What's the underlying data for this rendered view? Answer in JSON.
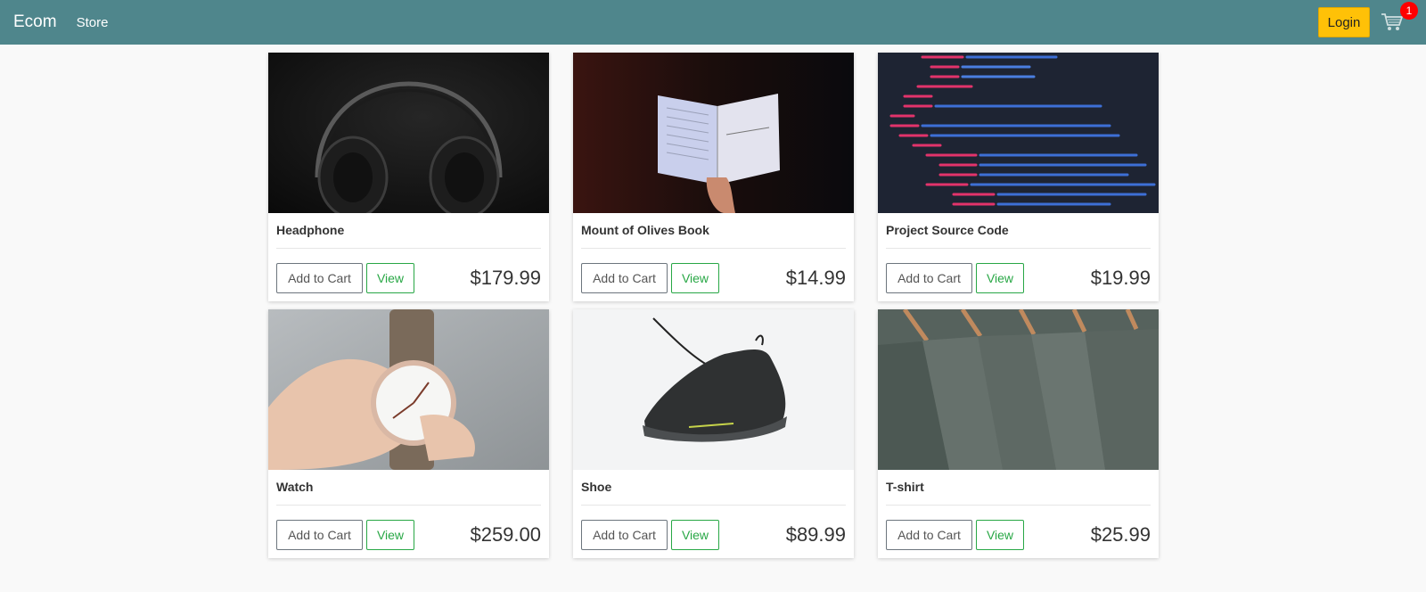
{
  "navbar": {
    "brand": "Ecom",
    "store_label": "Store",
    "login_label": "Login",
    "cart_count": "1"
  },
  "colors": {
    "navbar_bg": "#4f868c",
    "login_bg": "#ffc107",
    "badge_bg": "#ff0000",
    "view_border": "#28a745"
  },
  "products": [
    {
      "title": "Headphone",
      "price": "$179.99",
      "add_label": "Add to Cart",
      "view_label": "View"
    },
    {
      "title": "Mount of Olives Book",
      "price": "$14.99",
      "add_label": "Add to Cart",
      "view_label": "View"
    },
    {
      "title": "Project Source Code",
      "price": "$19.99",
      "add_label": "Add to Cart",
      "view_label": "View"
    },
    {
      "title": "Watch",
      "price": "$259.00",
      "add_label": "Add to Cart",
      "view_label": "View"
    },
    {
      "title": "Shoe",
      "price": "$89.99",
      "add_label": "Add to Cart",
      "view_label": "View"
    },
    {
      "title": "T-shirt",
      "price": "$25.99",
      "add_label": "Add to Cart",
      "view_label": "View"
    }
  ]
}
